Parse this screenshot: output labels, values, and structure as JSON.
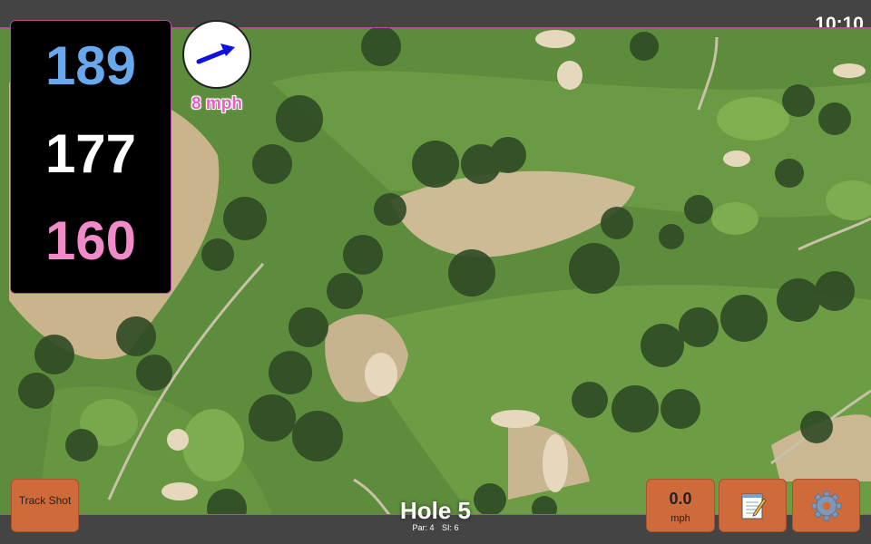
{
  "status": {
    "time": "10:10"
  },
  "distances": {
    "back": "189",
    "middle": "177",
    "front": "160",
    "back_color": "#6aa8ee",
    "middle_color": "#ffffff",
    "front_color": "#f08ac8"
  },
  "wind": {
    "speed": "8 mph",
    "direction_icon": "arrow-icon",
    "arrow_color": "#1010e0"
  },
  "hole": {
    "title": "Hole 5",
    "par": "Par: 4",
    "si": "SI: 6"
  },
  "buttons": {
    "track_shot": "Track Shot",
    "speed_value": "0.0",
    "speed_unit": "mph",
    "notes_icon": "notepad-icon",
    "settings_icon": "gear-icon"
  },
  "colors": {
    "button": "#cf6b3a",
    "accent_border": "#b0509a",
    "bar": "#444444"
  }
}
